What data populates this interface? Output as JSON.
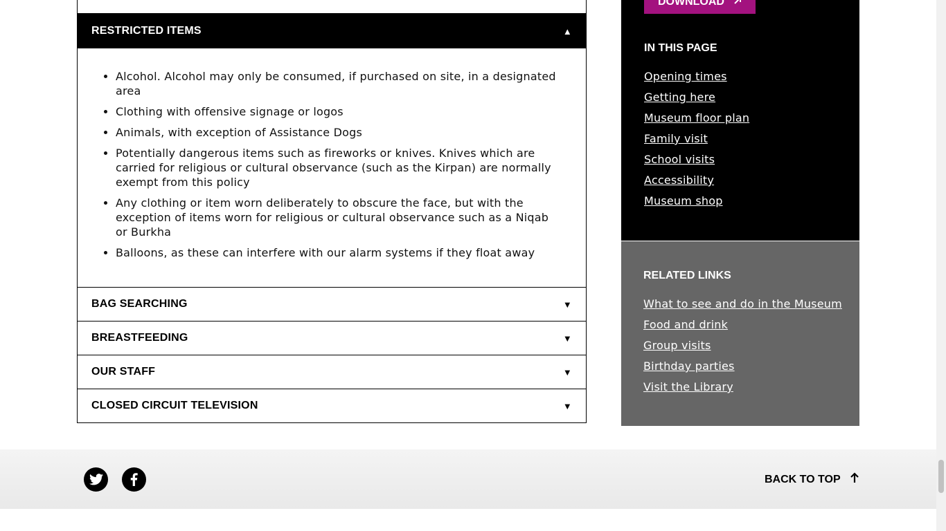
{
  "accordion": {
    "restricted": {
      "title": "RESTRICTED ITEMS",
      "arrow": "▲",
      "items": [
        "Alcohol. Alcohol may only be consumed, if purchased on site, in a designated area",
        "Clothing with offensive signage or logos",
        "Animals, with exception of Assistance Dogs",
        "Potentially dangerous items such as fireworks or knives. Knives which are carried for religious or cultural observance (such as the Kirpan) are normally exempt from this policy",
        "Any clothing or item worn deliberately to obscure the face, but with the exception of items worn for religious or cultural observance such as a Niqab or Burkha",
        "Balloons, as these can interfere with our alarm systems if they float away"
      ]
    },
    "collapsed": [
      {
        "title": "BAG SEARCHING",
        "arrow": "▼"
      },
      {
        "title": "BREASTFEEDING",
        "arrow": "▼"
      },
      {
        "title": "OUR STAFF",
        "arrow": "▼"
      },
      {
        "title": "CLOSED CIRCUIT TELEVISION",
        "arrow": "▼"
      }
    ]
  },
  "sidebar": {
    "download_label": "DOWNLOAD",
    "in_page": {
      "title": "IN THIS PAGE",
      "links": [
        "Opening times",
        "Getting here",
        "Museum floor plan",
        "Family visit",
        "School visits",
        "Accessibility",
        "Museum shop"
      ]
    },
    "related": {
      "title": "RELATED LINKS",
      "links": [
        "What to see and do in the Museum",
        "Food and drink",
        "Group visits",
        "Birthday parties",
        "Visit the Library"
      ]
    }
  },
  "footer": {
    "back_to_top": "BACK TO TOP",
    "social": [
      "twitter-icon",
      "facebook-icon"
    ]
  },
  "colors": {
    "accent": "#a3127f",
    "related_bg": "#666666",
    "in_page_bg": "#000000"
  }
}
